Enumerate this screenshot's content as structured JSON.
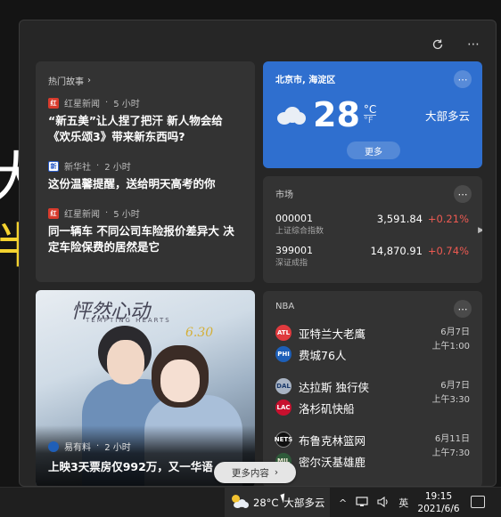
{
  "panel": {
    "refresh_icon": "refresh-icon",
    "more_icon": "ellipsis-icon"
  },
  "news": {
    "heading": "热门故事",
    "items": [
      {
        "source": "红星新闻",
        "time": "5 小时",
        "title": "“新五美”让人捏了把汗 新人物会给《欢乐颂3》带来新东西吗?",
        "logo": "红"
      },
      {
        "source": "新华社",
        "time": "2 小时",
        "title": "这份温馨提醒，送给明天高考的你",
        "logo": "新"
      },
      {
        "source": "红星新闻",
        "time": "5 小时",
        "title": "同一辆车 不同公司车险报价差异大 决定车险保费的居然是它",
        "logo": "红"
      }
    ]
  },
  "weather": {
    "location": "北京市, 海淀区",
    "temp": "28",
    "unit_c": "°C",
    "unit_f": "°F",
    "condition": "大部多云",
    "more_label": "更多",
    "accent": "#2f6fcf"
  },
  "market": {
    "title": "市场",
    "stocks": [
      {
        "code": "000001",
        "name": "上证综合指数",
        "price": "3,591.84",
        "change": "+0.21%"
      },
      {
        "code": "399001",
        "name": "深证成指",
        "price": "14,870.91",
        "change": "+0.74%"
      }
    ],
    "up_color": "#ee5a52"
  },
  "photo_news": {
    "art_title": "怦然心动",
    "art_sub": "TEMPTING HEARTS",
    "art_date": "6.30",
    "source": "易有料",
    "time": "2 小时",
    "headline": "上映3天票房仅992万，又一华语"
  },
  "nba": {
    "title": "NBA",
    "games": [
      {
        "home": "亚特兰大老鹰",
        "away": "费城76人",
        "date": "6月7日",
        "time": "上午1:00",
        "l1": "ATL",
        "l2": "PHI"
      },
      {
        "home": "达拉斯 独行侠",
        "away": "洛杉矶快船",
        "date": "6月7日",
        "time": "上午3:30",
        "l1": "DAL",
        "l2": "LAC"
      },
      {
        "home": "布鲁克林篮网",
        "away": "密尔沃基雄鹿",
        "date": "6月11日",
        "time": "上午7:30",
        "l1": "NETS",
        "l2": "MIL"
      }
    ]
  },
  "more_content": "更多内容",
  "taskbar": {
    "weather_temp": "28°C",
    "weather_cond": "大部多云",
    "ime": "英",
    "time": "19:15",
    "date": "2021/6/6"
  }
}
